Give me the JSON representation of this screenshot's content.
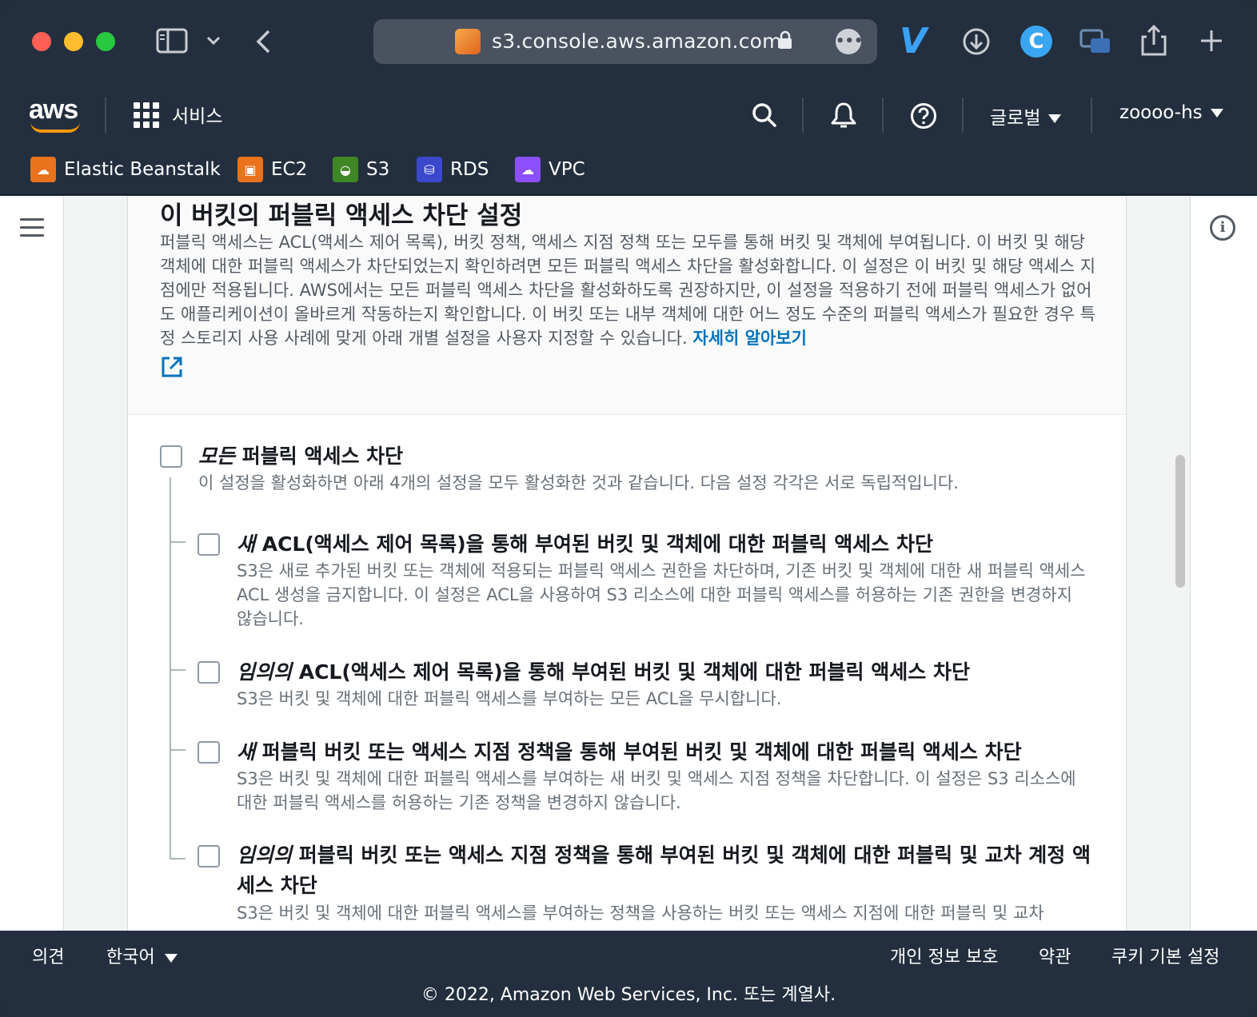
{
  "browser": {
    "url": "s3.console.aws.amazon.com"
  },
  "aws_header": {
    "logo_text": "aws",
    "services_label": "서비스",
    "region_label": "글로벌",
    "account_label": "zoooo-hs"
  },
  "favorites": [
    {
      "label": "Elastic Beanstalk",
      "color": "#e8731c",
      "icon": "elastic-beanstalk-icon"
    },
    {
      "label": "EC2",
      "color": "#e8731c",
      "icon": "ec2-icon"
    },
    {
      "label": "S3",
      "color": "#3f8624",
      "icon": "s3-icon"
    },
    {
      "label": "RDS",
      "color": "#3b48cc",
      "icon": "rds-icon"
    },
    {
      "label": "VPC",
      "color": "#8c4fff",
      "icon": "vpc-icon"
    }
  ],
  "section": {
    "title": "이 버킷의 퍼블릭 액세스 차단 설정",
    "description": "퍼블릭 액세스는 ACL(액세스 제어 목록), 버킷 정책, 액세스 지점 정책 또는 모두를 통해 버킷 및 객체에 부여됩니다. 이 버킷 및 해당 객체에 대한 퍼블릭 액세스가 차단되었는지 확인하려면 모든 퍼블릭 액세스 차단을 활성화합니다. 이 설정은 이 버킷 및 해당 액세스 지점에만 적용됩니다. AWS에서는 모든 퍼블릭 액세스 차단을 활성화하도록 권장하지만, 이 설정을 적용하기 전에 퍼블릭 액세스가 없어도 애플리케이션이 올바르게 작동하는지 확인합니다. 이 버킷 또는 내부 객체에 대한 어느 정도 수준의 퍼블릭 액세스가 필요한 경우 특정 스토리지 사용 사례에 맞게 아래 개별 설정을 사용자 지정할 수 있습니다.",
    "learn_more": "자세히 알아보기"
  },
  "options": {
    "all": {
      "title_em": "모든",
      "title_rest": "퍼블릭 액세스 차단",
      "description": "이 설정을 활성화하면 아래 4개의 설정을 모두 활성화한 것과 같습니다. 다음 설정 각각은 서로 독립적입니다.",
      "checked": false
    },
    "items": [
      {
        "title_em": "새",
        "title_rest": "ACL(액세스 제어 목록)을 통해 부여된 버킷 및 객체에 대한 퍼블릭 액세스 차단",
        "description": "S3은 새로 추가된 버킷 또는 객체에 적용되는 퍼블릭 액세스 권한을 차단하며, 기존 버킷 및 객체에 대한 새 퍼블릭 액세스 ACL 생성을 금지합니다. 이 설정은 ACL을 사용하여 S3 리소스에 대한 퍼블릭 액세스를 허용하는 기존 권한을 변경하지 않습니다.",
        "checked": false
      },
      {
        "title_em": "임의의",
        "title_rest": "ACL(액세스 제어 목록)을 통해 부여된 버킷 및 객체에 대한 퍼블릭 액세스 차단",
        "description": "S3은 버킷 및 객체에 대한 퍼블릭 액세스를 부여하는 모든 ACL을 무시합니다.",
        "checked": false
      },
      {
        "title_em": "새",
        "title_rest": "퍼블릭 버킷 또는 액세스 지점 정책을 통해 부여된 버킷 및 객체에 대한 퍼블릭 액세스 차단",
        "description": "S3은 버킷 및 객체에 대한 퍼블릭 액세스를 부여하는 새 버킷 및 액세스 지점 정책을 차단합니다. 이 설정은 S3 리소스에 대한 퍼블릭 액세스를 허용하는 기존 정책을 변경하지 않습니다.",
        "checked": false
      },
      {
        "title_em": "임의의",
        "title_rest": "퍼블릭 버킷 또는 액세스 지점 정책을 통해 부여된 버킷 및 객체에 대한 퍼블릭 및 교차 계정 액세스 차단",
        "description": "S3은 버킷 및 객체에 대한 퍼블릭 액세스를 부여하는 정책을 사용하는 버킷 또는 액세스 지점에 대한 퍼블릭 및 교차",
        "checked": false
      }
    ]
  },
  "footer": {
    "feedback": "의견",
    "language": "한국어",
    "privacy": "개인 정보 보호",
    "terms": "약관",
    "cookies": "쿠키 기본 설정",
    "copyright": "© 2022, Amazon Web Services, Inc. 또는 계열사."
  }
}
